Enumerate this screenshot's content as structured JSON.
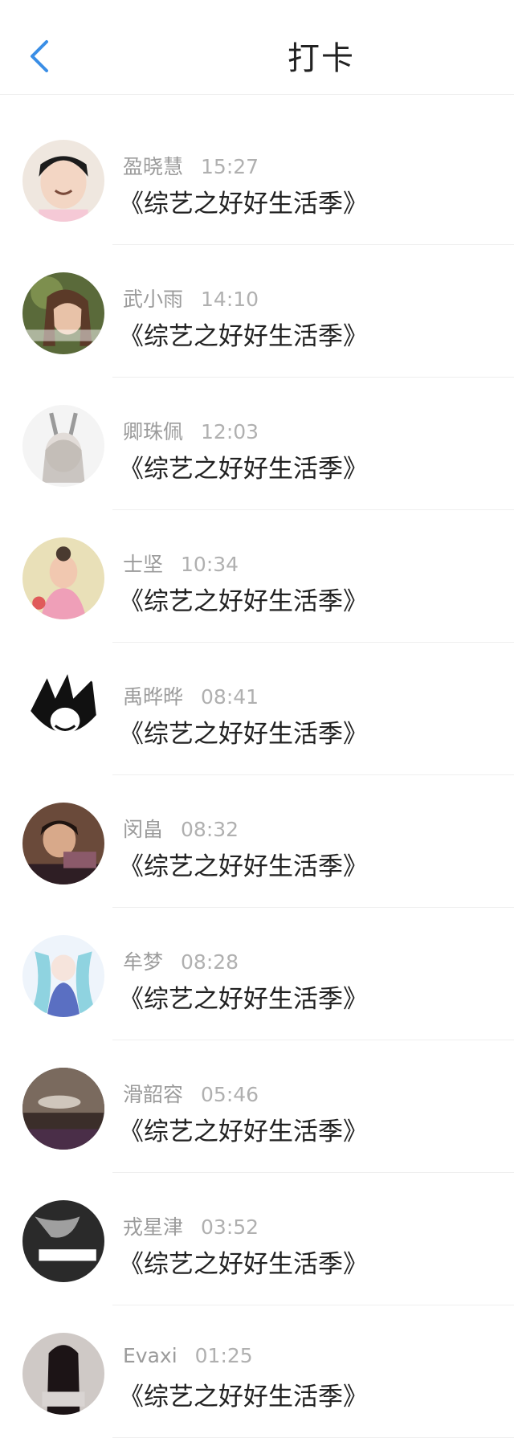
{
  "header": {
    "title": "打卡"
  },
  "items": [
    {
      "name": "盈晓慧",
      "time": "15:27",
      "title": "《综艺之好好生活季》"
    },
    {
      "name": "武小雨",
      "time": "14:10",
      "title": "《综艺之好好生活季》"
    },
    {
      "name": "卿珠佩",
      "time": "12:03",
      "title": "《综艺之好好生活季》"
    },
    {
      "name": "士坚",
      "time": "10:34",
      "title": "《综艺之好好生活季》"
    },
    {
      "name": "禹晔晔",
      "time": "08:41",
      "title": "《综艺之好好生活季》"
    },
    {
      "name": "闵畠",
      "time": "08:32",
      "title": "《综艺之好好生活季》"
    },
    {
      "name": "牟梦",
      "time": "08:28",
      "title": "《综艺之好好生活季》"
    },
    {
      "name": "滑韶容",
      "time": "05:46",
      "title": "《综艺之好好生活季》"
    },
    {
      "name": "戎星津",
      "time": "03:52",
      "title": "《综艺之好好生活季》"
    },
    {
      "name": "Evaxi",
      "time": "01:25",
      "title": "《综艺之好好生活季》"
    }
  ],
  "colors": {
    "accent": "#3a8ee6",
    "text": "#222222",
    "meta": "#9b9b9b"
  }
}
